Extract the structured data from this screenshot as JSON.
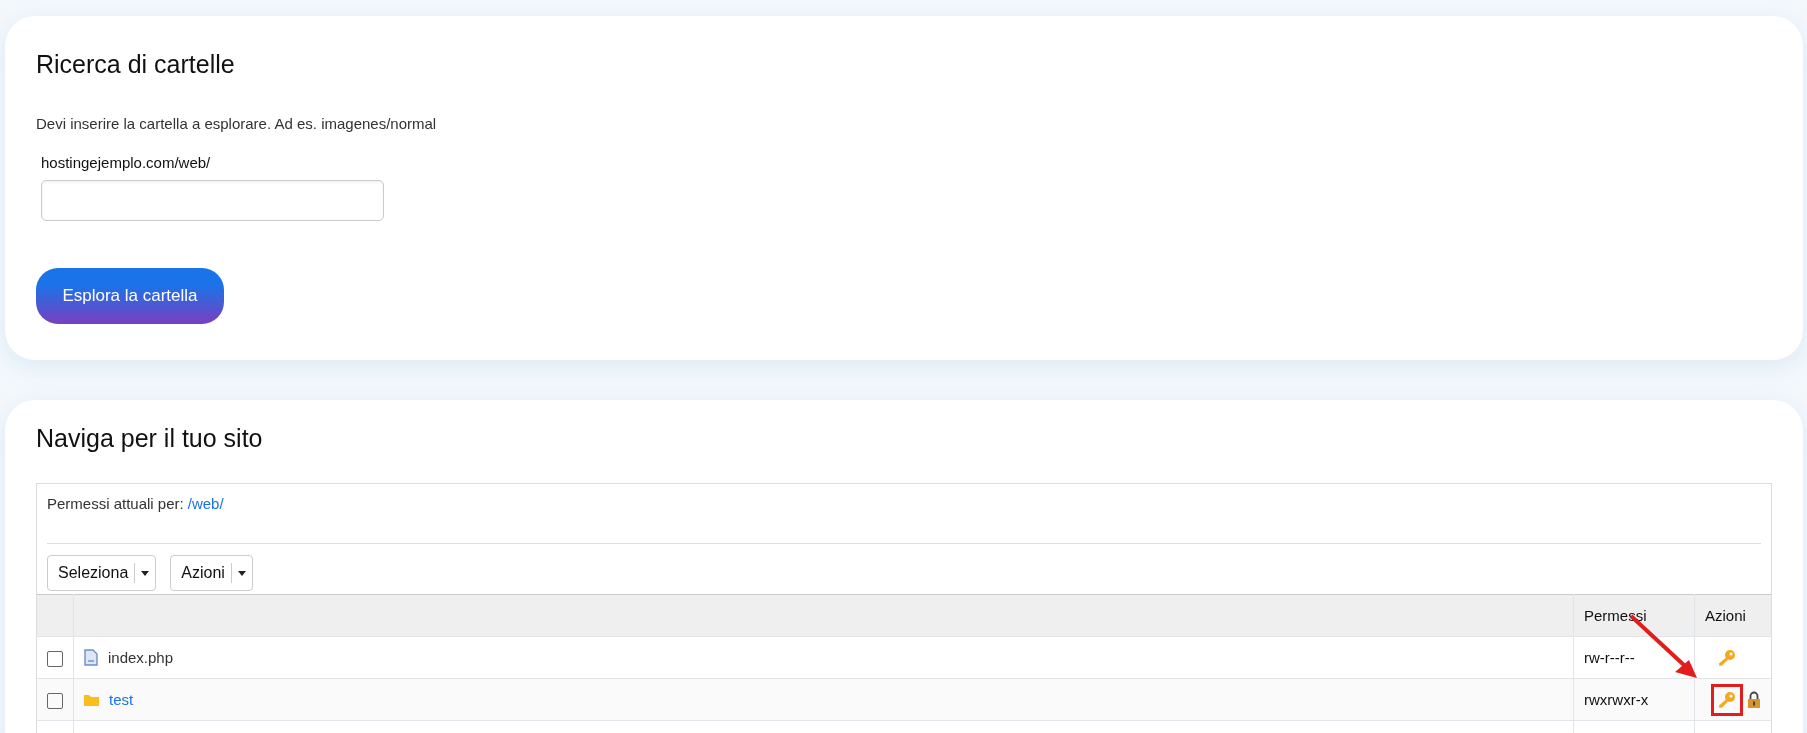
{
  "search_card": {
    "title": "Ricerca di cartelle",
    "hint": "Devi inserire la cartella a esplorare. Ad es. imagenes/normal",
    "field_label": "hostingejemplo.com/web/",
    "button": "Esplora la cartella"
  },
  "browser_card": {
    "title": "Naviga per il tuo sito",
    "current_label": "Permessi attuali per:",
    "current_path": "/web/",
    "dropdowns": [
      "Seleziona",
      "Azioni"
    ],
    "columns": [
      "Permessi",
      "Azioni"
    ],
    "rows": [
      {
        "kind": "file",
        "name": "index.php",
        "permissions": "rw-r--r--",
        "checked": false,
        "locked": false,
        "highlighted": false
      },
      {
        "kind": "folder",
        "name": "test",
        "permissions": "rwxrwxr-x",
        "checked": false,
        "locked": true,
        "highlighted": true
      }
    ]
  }
}
